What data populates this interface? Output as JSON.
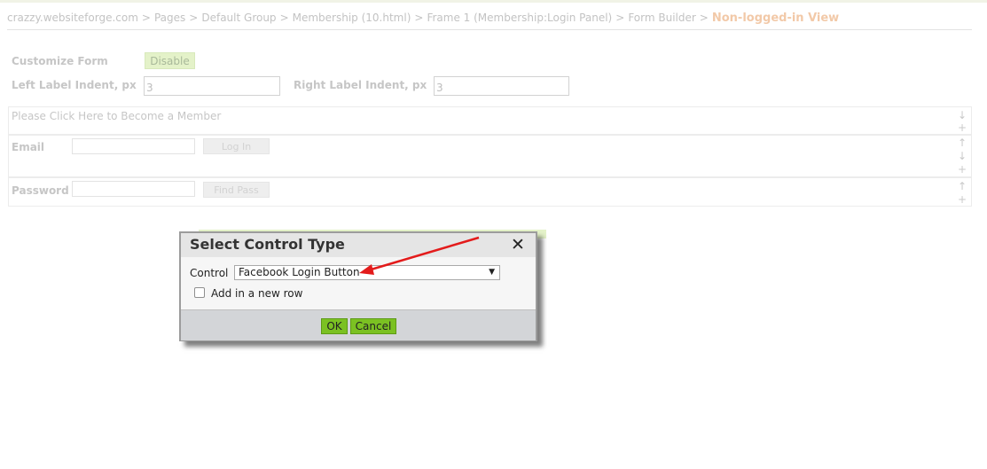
{
  "breadcrumb": {
    "items": [
      "crazzy.websiteforge.com",
      "Pages",
      "Default Group",
      "Membership (10.html)",
      "Frame 1 (Membership:Login Panel)",
      "Form Builder"
    ],
    "separator": ">",
    "current": "Non-logged-in View"
  },
  "settings": {
    "customize_form_label": "Customize Form",
    "disable_button": "Disable",
    "left_indent_label": "Left Label Indent, px",
    "left_indent_value": "3",
    "right_indent_label": "Right Label Indent, px",
    "right_indent_value": "3"
  },
  "form_rows": [
    {
      "text": "Please Click Here to Become a Member",
      "controls": [
        "arrow-down",
        "plus"
      ]
    },
    {
      "label": "Email",
      "button": "Log In",
      "controls": [
        "arrow-up",
        "arrow-down",
        "plus"
      ]
    },
    {
      "label": "Password",
      "button": "Find Pass",
      "controls": [
        "arrow-up",
        "plus"
      ]
    }
  ],
  "dialog": {
    "title": "Select Control Type",
    "close_icon": "close-icon",
    "control_label": "Control",
    "selected_control": "Facebook Login Button",
    "checkbox_label": "Add in a new row",
    "checkbox_checked": false,
    "ok_button": "OK",
    "cancel_button": "Cancel"
  },
  "colors": {
    "accent_green": "#7bc122",
    "breadcrumb_current": "#f2c9a8",
    "annotation_arrow": "#e31b1b"
  }
}
